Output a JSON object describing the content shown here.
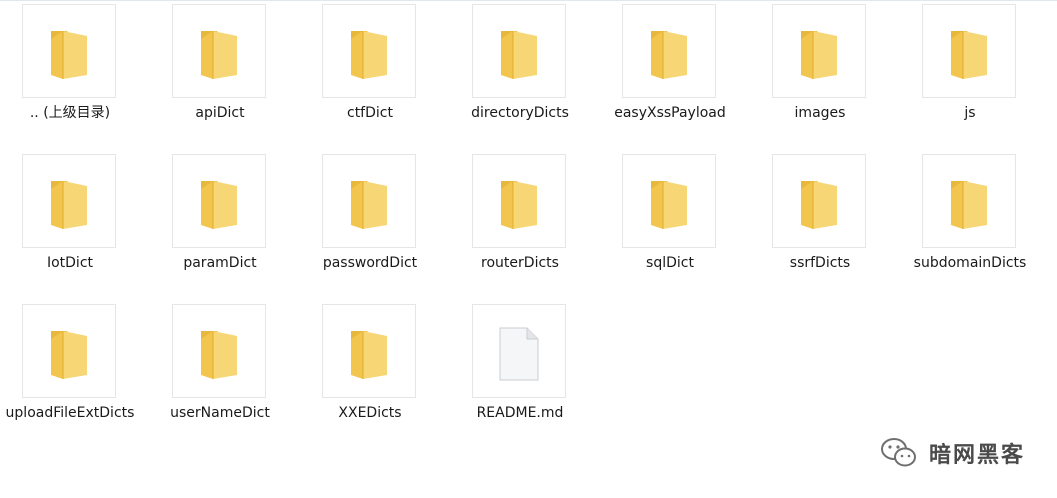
{
  "items": [
    {
      "name": ".. (上级目录)",
      "type": "folder"
    },
    {
      "name": "apiDict",
      "type": "folder"
    },
    {
      "name": "ctfDict",
      "type": "folder"
    },
    {
      "name": "directoryDicts",
      "type": "folder"
    },
    {
      "name": "easyXssPayload",
      "type": "folder"
    },
    {
      "name": "images",
      "type": "folder"
    },
    {
      "name": "js",
      "type": "folder"
    },
    {
      "name": "IotDict",
      "type": "folder"
    },
    {
      "name": "paramDict",
      "type": "folder"
    },
    {
      "name": "passwordDict",
      "type": "folder"
    },
    {
      "name": "routerDicts",
      "type": "folder"
    },
    {
      "name": "sqlDict",
      "type": "folder"
    },
    {
      "name": "ssrfDicts",
      "type": "folder"
    },
    {
      "name": "subdomainDicts",
      "type": "folder"
    },
    {
      "name": "uploadFileExtDicts",
      "type": "folder"
    },
    {
      "name": "userNameDict",
      "type": "folder"
    },
    {
      "name": "XXEDicts",
      "type": "folder"
    },
    {
      "name": "README.md",
      "type": "file"
    }
  ],
  "watermark": {
    "text": "暗网黑客",
    "icon": "wechat-icon"
  },
  "colors": {
    "folder_front": "#f7d676",
    "folder_back": "#e8b83c",
    "file_fill": "#f5f6f7",
    "file_stroke": "#c9cdd2"
  }
}
